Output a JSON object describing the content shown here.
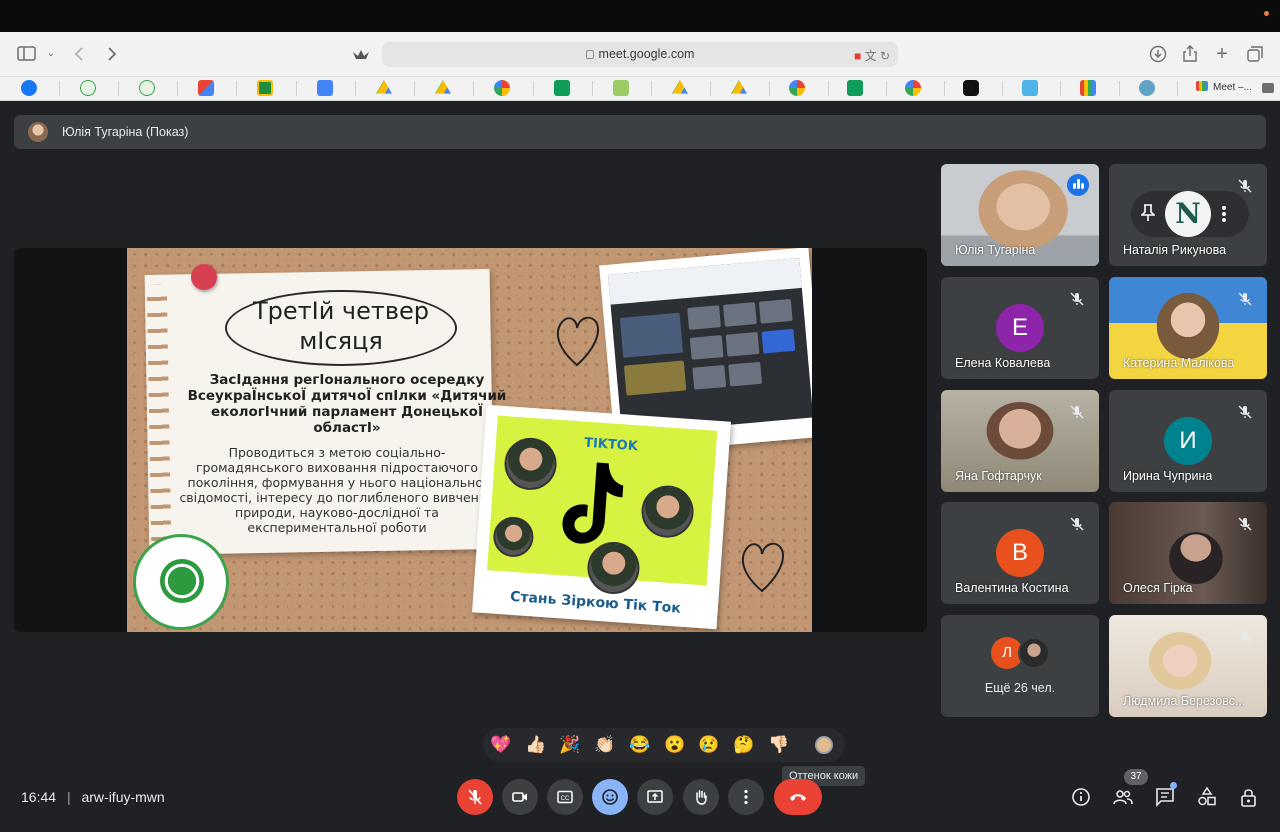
{
  "browser": {
    "url": "meet.google.com",
    "active_tab_label": "Meet –...",
    "bookmarks": [
      "facebook-icon",
      "shield-icon",
      "shield-icon",
      "gmail-icon",
      "classroom-icon",
      "docs-icon",
      "drive-icon",
      "drive-icon",
      "google-icon",
      "sheets-icon",
      "archive-icon",
      "drive-icon",
      "drive-icon",
      "google-icon",
      "sheets-icon",
      "google-icon",
      "help-icon",
      "form-icon",
      "meet-icon",
      "ocean-icon"
    ]
  },
  "meet": {
    "presenting_label": "Юлія Тугаріна (Показ)",
    "slide": {
      "title": "ТретІй четвер мІсяця",
      "subtitle": "ЗасІдання регIонального осередку ВсеукраЇнськоЇ дитячоЇ спIлки «Дитячий екологIчний парламент ДонецькоЇ областI»",
      "body": "Проводиться з метою соціально-громадянського виховання підростаючого покоління, формування у нього національної свідомості, інтересу до поглибленого вивчення природи, науково-дослідної та експериментальної роботи",
      "tiktok_label": "TIKTOK",
      "tiktok_caption": "Стань Зіркою Тік Ток"
    },
    "participants": [
      {
        "name": "Юлія Тугаріна",
        "kind": "video-speaking"
      },
      {
        "name": "Наталія Рикунова",
        "kind": "logo"
      },
      {
        "name": "Елена Ковалева",
        "kind": "letter",
        "letter": "Е",
        "color": "#8e24aa"
      },
      {
        "name": "Катерина Малікова",
        "kind": "video"
      },
      {
        "name": "Яна Гофтарчук",
        "kind": "video"
      },
      {
        "name": "Ирина Чуприна",
        "kind": "letter",
        "letter": "И",
        "color": "#00838f"
      },
      {
        "name": "Валентина Костина",
        "kind": "letter",
        "letter": "В",
        "color": "#e8501d"
      },
      {
        "name": "Олеся Гірка",
        "kind": "video"
      },
      {
        "name": "Людмила Березовс...",
        "kind": "video"
      }
    ],
    "more": {
      "letter": "Л",
      "text": "Ещё 26 чел."
    },
    "reactions": [
      "💖",
      "👍🏻",
      "🎉",
      "👏🏻",
      "😂",
      "😮",
      "😢",
      "🤔",
      "👎🏻"
    ],
    "skin_tone_tooltip": "Оттенок кожи",
    "time": "16:44",
    "meeting_code": "arw-ifuy-mwn",
    "participants_count": "37",
    "colors": {
      "accent": "#8ab4f8",
      "danger": "#ea4335",
      "surface": "#3c4043",
      "background": "#202124"
    }
  }
}
